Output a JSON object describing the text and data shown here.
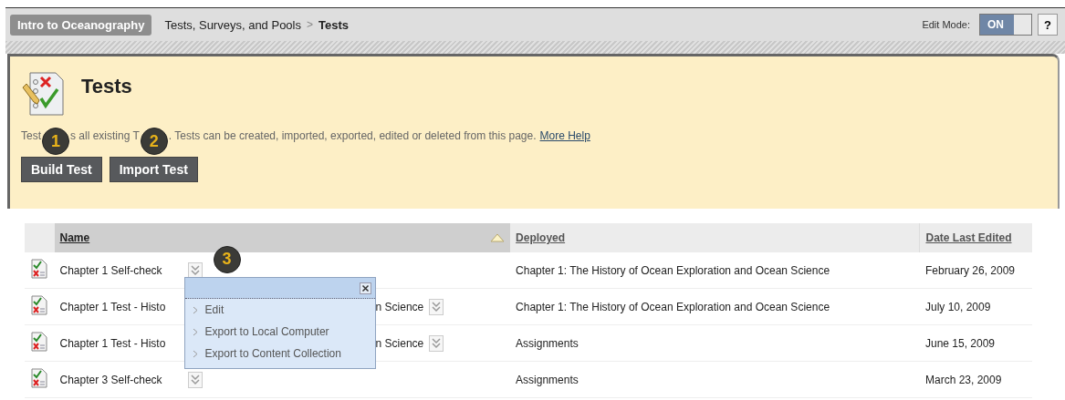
{
  "breadcrumb": {
    "course": "Intro to Oceanography",
    "path": "Tests, Surveys, and Pools",
    "separator": ">",
    "current": "Tests"
  },
  "edit_mode": {
    "label": "Edit Mode:",
    "state": "ON",
    "on": true,
    "help": "?"
  },
  "page": {
    "title": "Tests",
    "description": [
      {
        "kind": "text",
        "text": "Test"
      },
      {
        "kind": "callout",
        "text": "1"
      },
      {
        "kind": "text",
        "text": "s all existing T"
      },
      {
        "kind": "callout",
        "text": "2"
      },
      {
        "kind": "text",
        "text": ". Tests can be created, imported, exported, edited or deleted from this page."
      },
      {
        "kind": "link",
        "text": "More Help"
      }
    ],
    "buttons": [
      "Build Test",
      "Import Test"
    ]
  },
  "table": {
    "columns": [
      {
        "label": "Name",
        "sorted": true
      },
      {
        "label": "Deployed",
        "sorted": false
      },
      {
        "label": "Date Last Edited",
        "sorted": false
      }
    ],
    "rows": [
      {
        "name_parts": [
          "Chapter 1 Self-check"
        ],
        "callout": "3",
        "deployed": "Chapter 1: The History of Ocean Exploration and Ocean Science",
        "date": "February 26, 2009"
      },
      {
        "name_parts": [
          "Chapter 1 Test - Histo",
          "n Science"
        ],
        "deployed": "Chapter 1: The History of Ocean Exploration and Ocean Science",
        "date": "July 10, 2009"
      },
      {
        "name_parts": [
          "Chapter 1 Test - Histo",
          "n Science"
        ],
        "deployed": "Assignments",
        "date": "June 15, 2009"
      },
      {
        "name_parts": [
          "Chapter 3 Self-check"
        ],
        "deployed": "Assignments",
        "date": "March 23, 2009"
      }
    ]
  },
  "context_menu": {
    "items": [
      "Edit",
      "Export to Local Computer",
      "Export to Content Collection"
    ]
  }
}
